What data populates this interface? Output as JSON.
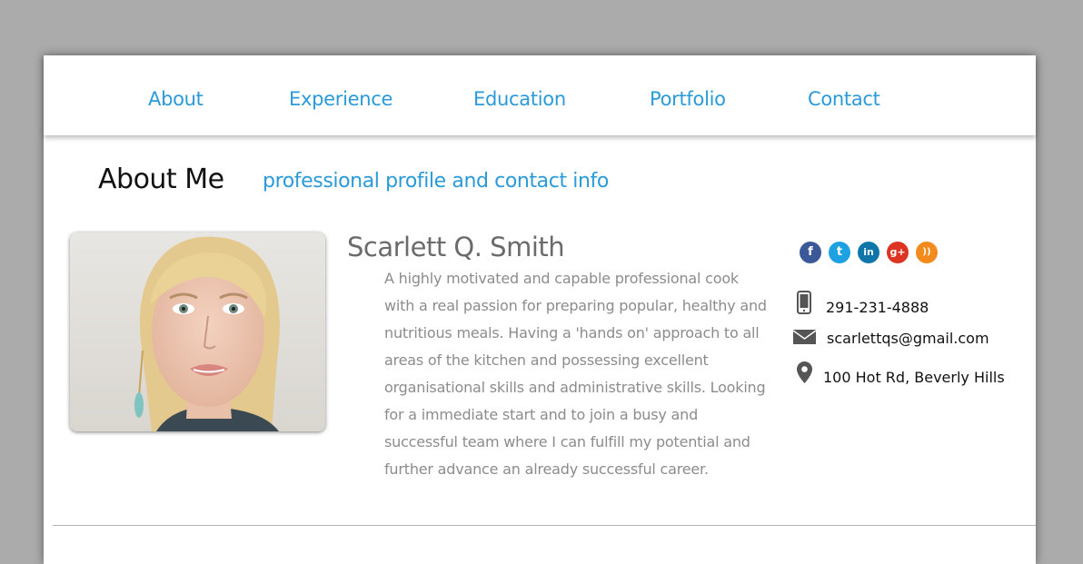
{
  "nav": {
    "items": [
      {
        "label": "About"
      },
      {
        "label": "Experience"
      },
      {
        "label": "Education"
      },
      {
        "label": "Portfolio"
      },
      {
        "label": "Contact"
      }
    ]
  },
  "section": {
    "title": "About Me",
    "subtitle": "professional profile and contact info"
  },
  "profile": {
    "name": "Scarlett Q. Smith",
    "bio": "A highly motivated and capable professional cook with a real passion for preparing popular, healthy and nutritious meals. Having a 'hands on' approach to all areas of the kitchen and possessing excellent organisational skills and administrative skills. Looking for a immediate start and to join a busy and successful team where I can fulfill my potential and further advance an already successful career."
  },
  "social": [
    {
      "icon": "facebook-icon",
      "glyph": "f",
      "color": "#3b5998"
    },
    {
      "icon": "twitter-icon",
      "glyph": "t",
      "color": "#1da1e2"
    },
    {
      "icon": "linkedin-icon",
      "glyph": "in",
      "color": "#0e76a8"
    },
    {
      "icon": "google-plus-icon",
      "glyph": "g+",
      "color": "#dd3322"
    },
    {
      "icon": "rss-icon",
      "glyph": "))",
      "color": "#f28a1c"
    }
  ],
  "contact": {
    "phone": "291-231-4888",
    "email": "scarlettqs@gmail.com",
    "address": "100 Hot Rd, Beverly Hills"
  },
  "colors": {
    "accent": "#2a9ad8",
    "background": "#ababab",
    "card": "#ffffff"
  }
}
